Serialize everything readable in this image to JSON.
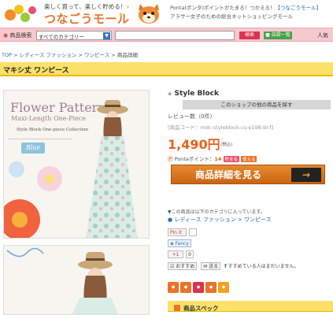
{
  "header": {
    "tagline": "楽しく買って、楽しく貯める！",
    "logo_text": "つなごうモール",
    "ponta_line": "Ponta(ポンタ)ポイントがたまる！つかえる！",
    "ponta_link": "【つなごうモール】",
    "subtitle": "アラサー女子のための総合ネットショッピングモール"
  },
  "search": {
    "label": "商品検索",
    "category_selected": "すべてのカテゴリー",
    "query": "",
    "search_button": "検索",
    "category_button": "自録一覧",
    "popular_label": "人気"
  },
  "breadcrumb": {
    "items": [
      "TOP",
      "レディース ファッション",
      "ワンピース",
      "商品詳細"
    ]
  },
  "page_title": "マキシ丈 ワンピース",
  "image_text": {
    "title": "Flower Pattern",
    "subtitle": "Maxi-Length One-Piece",
    "collection": "Style Block One-piece Collection",
    "color_badge": "Blue"
  },
  "product": {
    "shop_name": "Style Block",
    "shop_other_button": "このショップの他の商品を探す",
    "review": "レビュー数（0件）",
    "product_code": "[商品コード：mdc-styleblock-cs-e198-bl-f]",
    "price": "1,490円",
    "tax": "(税込)",
    "ponta_label": "Pontaポイント：",
    "ponta_points": "14",
    "tag_earn": "貯まる",
    "tag_use": "使える",
    "detail_button": "商品詳細を見る",
    "detail_arrow": "→"
  },
  "categories": {
    "note": "▼この商品は以下のカテゴリに入っています。",
    "path": "● レディース ファッション > ワンピース"
  },
  "social": {
    "pin_label": "Pin it",
    "pin_count": "",
    "fancy_label": "Fancy",
    "gplus_label": "+1",
    "gplus_count": "0",
    "osusume": "おすすめ",
    "okuru": "送る",
    "fb_text": "すすめている人はまだいません。"
  },
  "spec_title": "商品スペック",
  "colors": {
    "accent_orange": "#e8732a",
    "title_yellow": "#fbe06a",
    "search_pink": "#f6c9cf",
    "price_orange": "#e8611a",
    "link_blue": "#2a6ab8"
  }
}
